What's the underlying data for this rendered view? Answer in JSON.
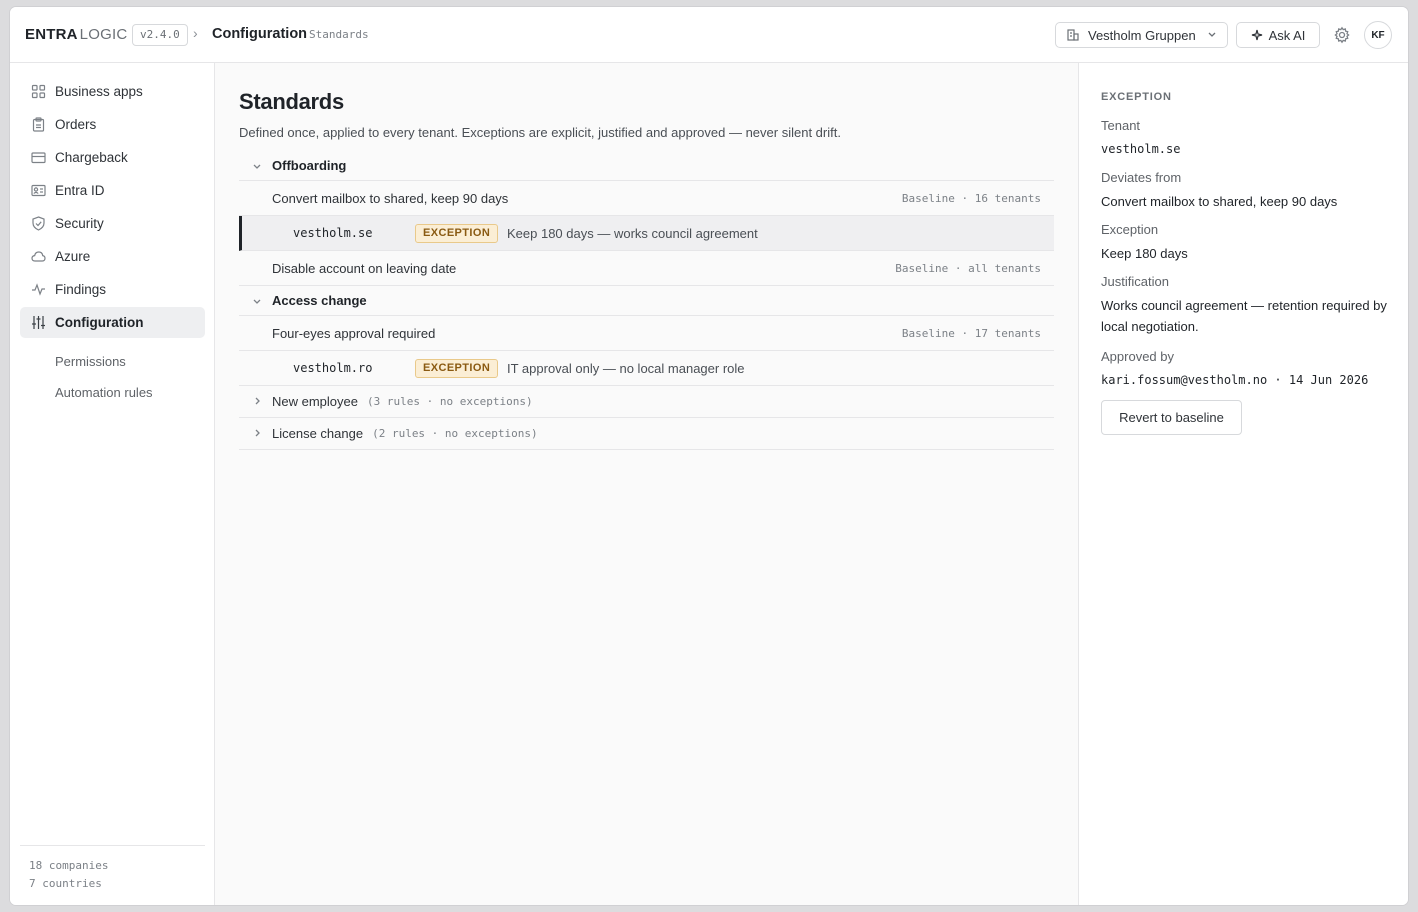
{
  "header": {
    "brand_primary": "ENTRA",
    "brand_secondary": "LOGIC",
    "version": "v2.4.0",
    "breadcrumb_separator": "›",
    "breadcrumb_main": "Configuration",
    "breadcrumb_sub": "Standards",
    "tenant_selector": "Vestholm Gruppen",
    "ask_ai_label": "Ask AI",
    "user_initials": "KF"
  },
  "sidebar": {
    "items": [
      {
        "label": "Business apps",
        "icon": "grid-icon"
      },
      {
        "label": "Orders",
        "icon": "clipboard-icon"
      },
      {
        "label": "Chargeback",
        "icon": "credit-card-icon"
      },
      {
        "label": "Entra ID",
        "icon": "id-card-icon"
      },
      {
        "label": "Security",
        "icon": "shield-icon"
      },
      {
        "label": "Azure",
        "icon": "cloud-icon"
      },
      {
        "label": "Findings",
        "icon": "activity-icon"
      },
      {
        "label": "Configuration",
        "icon": "sliders-icon",
        "active": true
      }
    ],
    "sub_items": [
      {
        "label": "Permissions"
      },
      {
        "label": "Automation rules"
      }
    ],
    "footer": {
      "companies": "18 companies",
      "countries": "7 countries"
    }
  },
  "main": {
    "title": "Standards",
    "description": "Defined once, applied to every tenant. Exceptions are explicit, justified and approved — never silent drift.",
    "groups": [
      {
        "name": "Offboarding",
        "rules": [
          {
            "name": "Convert mailbox to shared, keep 90 days",
            "meta": "Baseline · 16 tenants",
            "exception": {
              "tenant": "vestholm.se",
              "badge": "EXCEPTION",
              "text": "Keep 180 days — works council agreement"
            }
          },
          {
            "name": "Disable account on leaving date",
            "meta": "Baseline · all tenants"
          }
        ]
      },
      {
        "name": "Access change",
        "rules": [
          {
            "name": "Four-eyes approval required",
            "meta": "Baseline · 17 tenants",
            "exception": {
              "tenant": "vestholm.ro",
              "badge": "EXCEPTION",
              "text": "IT approval only — no local manager role"
            }
          }
        ]
      },
      {
        "name": "New employee",
        "meta": "(3 rules · no exceptions)"
      },
      {
        "name": "License change",
        "meta": "(2 rules · no exceptions)"
      }
    ]
  },
  "panel": {
    "heading": "EXCEPTION",
    "tenant_label": "Tenant",
    "tenant_value": "vestholm.se",
    "deviates_label": "Deviates from",
    "deviates_value": "Convert mailbox to shared, keep 90 days",
    "exception_label": "Exception",
    "exception_value": "Keep 180 days",
    "justification_label": "Justification",
    "justification_value": "Works council agreement — retention required by local negotiation.",
    "approved_label": "Approved by",
    "approved_value": "kari.fossum@vestholm.no · 14 Jun 2026",
    "revert_label": "Revert to baseline"
  },
  "colors": {
    "accent": "#1f2328",
    "exception_badge_bg": "#fbeed5",
    "exception_badge_text": "#8a5a12"
  }
}
